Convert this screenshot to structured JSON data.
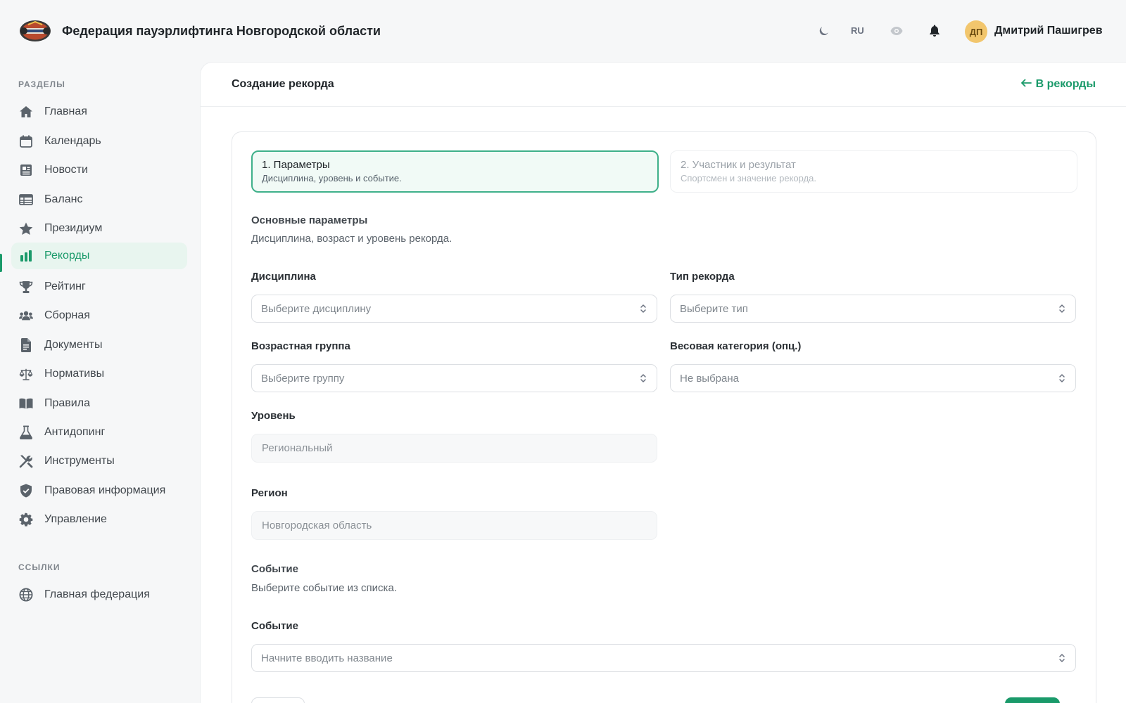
{
  "header": {
    "title": "Федерация пауэрлифтинга Новгородской области",
    "lang": "RU",
    "user": {
      "initials": "ДП",
      "name": "Дмитрий Пашигрев"
    }
  },
  "sidebar": {
    "sections_label": "РАЗДЕЛЫ",
    "items": [
      {
        "label": "Главная",
        "icon": "home-icon"
      },
      {
        "label": "Календарь",
        "icon": "calendar-icon"
      },
      {
        "label": "Новости",
        "icon": "newspaper-icon"
      },
      {
        "label": "Баланс",
        "icon": "table-icon"
      },
      {
        "label": "Президиум",
        "icon": "star-icon"
      },
      {
        "label": "Рекорды",
        "icon": "bar-chart-icon",
        "active": true
      },
      {
        "label": "Рейтинг",
        "icon": "trophy-icon"
      },
      {
        "label": "Сборная",
        "icon": "users-icon"
      },
      {
        "label": "Документы",
        "icon": "document-icon"
      },
      {
        "label": "Нормативы",
        "icon": "scales-icon"
      },
      {
        "label": "Правила",
        "icon": "book-icon"
      },
      {
        "label": "Антидопинг",
        "icon": "flask-icon"
      },
      {
        "label": "Инструменты",
        "icon": "tools-icon"
      },
      {
        "label": "Правовая информация",
        "icon": "shield-icon"
      },
      {
        "label": "Управление",
        "icon": "gear-icon"
      }
    ],
    "links_label": "ССЫЛКИ",
    "links": [
      {
        "label": "Главная федерация",
        "icon": "globe-icon"
      }
    ]
  },
  "page": {
    "title": "Создание рекорда",
    "back_label": "В рекорды"
  },
  "steps": [
    {
      "title": "1. Параметры",
      "subtitle": "Дисциплина, уровень и событие."
    },
    {
      "title": "2. Участник и результат",
      "subtitle": "Спортсмен и значение рекорда."
    }
  ],
  "params": {
    "title": "Основные параметры",
    "subtitle": "Дисциплина, возраст и уровень рекорда.",
    "discipline": {
      "label": "Дисциплина",
      "placeholder": "Выберите дисциплину"
    },
    "record_type": {
      "label": "Тип рекорда",
      "placeholder": "Выберите тип"
    },
    "age_group": {
      "label": "Возрастная группа",
      "placeholder": "Выберите группу"
    },
    "weight_class": {
      "label": "Весовая категория (опц.)",
      "placeholder": "Не выбрана"
    },
    "level": {
      "label": "Уровень",
      "value": "Региональный"
    },
    "region": {
      "label": "Регион",
      "value": "Новгородская область"
    }
  },
  "event": {
    "title": "Событие",
    "subtitle": "Выберите событие из списка.",
    "field": {
      "label": "Событие",
      "placeholder": "Начните вводить название"
    }
  },
  "colors": {
    "accent": "#1a9a6a",
    "active_bg": "#e8f5ef",
    "avatar": "#f2c66d"
  }
}
